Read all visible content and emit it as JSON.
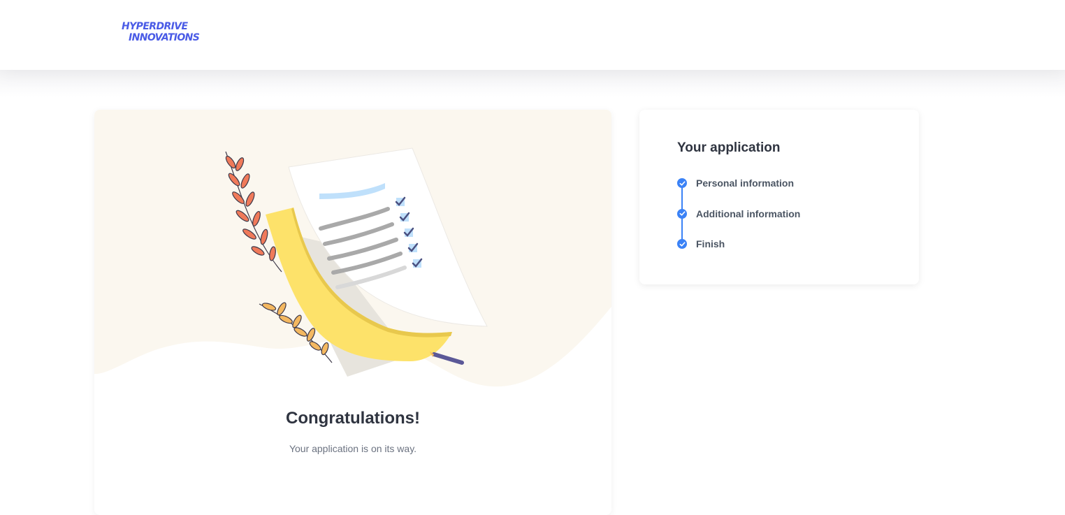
{
  "brand": {
    "line1": "HYPERDRIVE",
    "line2": "INNOVATIONS",
    "color": "#4a5be6"
  },
  "success": {
    "title": "Congratulations!",
    "subtitle": "Your application is on its way.",
    "illustration": "documents-checklist-illustration"
  },
  "application": {
    "title": "Your application",
    "steps": [
      {
        "label": "Personal information",
        "status": "complete",
        "icon": "check-icon"
      },
      {
        "label": "Additional information",
        "status": "complete",
        "icon": "check-icon"
      },
      {
        "label": "Finish",
        "status": "complete",
        "icon": "check-icon"
      }
    ]
  },
  "colors": {
    "accent": "#3b82f6",
    "illustration_bg": "#fbf7ef",
    "paper_yellow": "#fde26a",
    "leaf_red": "#f07a5a",
    "leaf_orange": "#f4b860"
  }
}
